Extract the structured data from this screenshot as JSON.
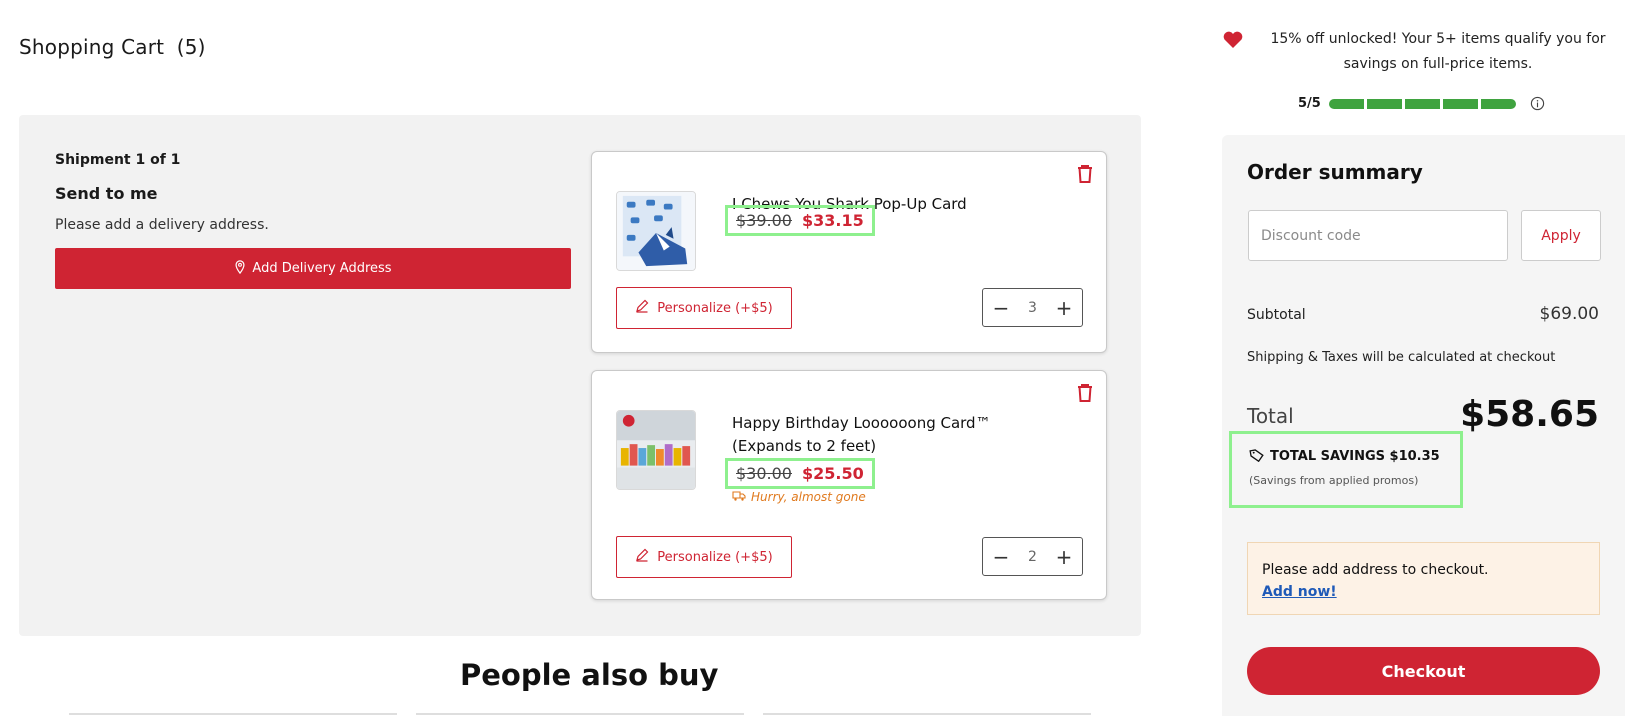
{
  "cart": {
    "title": "Shopping Cart",
    "count": "(5)"
  },
  "shipment": {
    "label": "Shipment 1 of 1",
    "send_to": "Send to me",
    "address_note": "Please add a delivery address.",
    "add_address_label": "Add Delivery Address"
  },
  "items": [
    {
      "name": "I Chews You Shark Pop-Up Card",
      "old_price": "$39.00",
      "new_price": "$33.15",
      "personalize_label": "Personalize (+$5)",
      "quantity": "3",
      "note": ""
    },
    {
      "name": "Happy Birthday Loooooong Card™ (Expands to 2 feet)",
      "old_price": "$30.00",
      "new_price": "$25.50",
      "personalize_label": "Personalize (+$5)",
      "quantity": "2",
      "note": "Hurry, almost gone"
    }
  ],
  "recommendations": {
    "title": "People also buy"
  },
  "promo": {
    "text": "15% off unlocked! Your 5+ items qualify you for savings on full-price items.",
    "progress_label": "5/5",
    "progress_filled": 5,
    "progress_total": 5
  },
  "summary": {
    "title": "Order summary",
    "discount_placeholder": "Discount code",
    "apply_label": "Apply",
    "subtotal_label": "Subtotal",
    "subtotal_value": "$69.00",
    "shipping_note": "Shipping & Taxes will be calculated at checkout",
    "total_label": "Total",
    "total_value": "$58.65",
    "savings_title": "TOTAL SAVINGS $10.35",
    "savings_note": "(Savings from applied promos)",
    "checkout_note": "Please add address to checkout.",
    "checkout_link": "Add now!",
    "checkout_label": "Checkout"
  },
  "colors": {
    "brand_red": "#cf2433",
    "progress_green": "#3fa33f",
    "highlight_green": "#8ef08e",
    "warning_orange": "#e07a1f",
    "link_blue": "#1f5ab8"
  },
  "icons": [
    "heart-icon",
    "info-icon",
    "location-pin-icon",
    "trash-icon",
    "pencil-icon",
    "minus-icon",
    "plus-icon",
    "truck-icon",
    "tag-icon"
  ]
}
